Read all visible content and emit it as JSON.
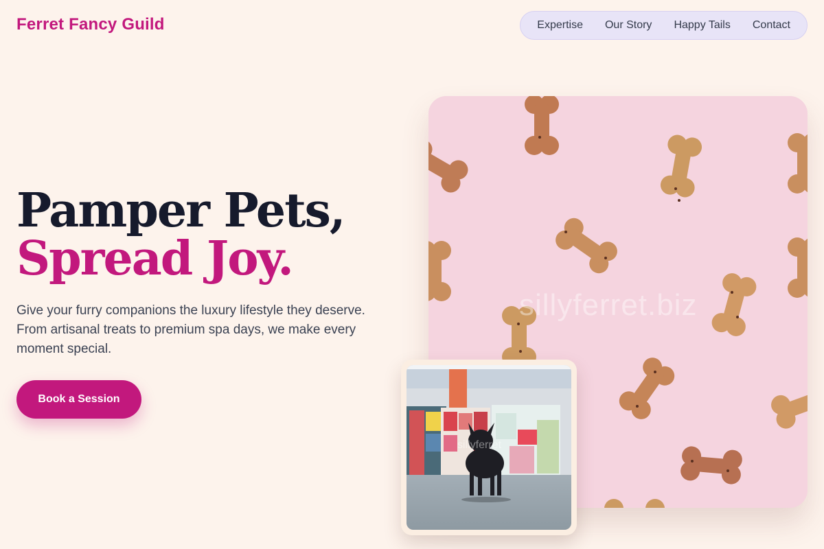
{
  "brand": {
    "name": "Ferret Fancy Guild"
  },
  "nav": {
    "items": [
      {
        "label": "Expertise"
      },
      {
        "label": "Our Story"
      },
      {
        "label": "Happy Tails"
      },
      {
        "label": "Contact"
      }
    ]
  },
  "hero": {
    "headline_line1": "Pamper Pets,",
    "headline_line2": "Spread Joy.",
    "description": "Give your furry companions the luxury lifestyle they deserve. From artisanal treats to premium spa days, we make every moment special.",
    "cta_label": "Book a Session"
  },
  "images": {
    "main_watermark": "sillyferret.biz",
    "small_watermark": "sillyferret"
  },
  "colors": {
    "background": "#fdf3ec",
    "accent": "#c2187d",
    "heading": "#161a2c",
    "nav_pill": "#e8e4f7",
    "photo_pink": "#f5d4df"
  }
}
